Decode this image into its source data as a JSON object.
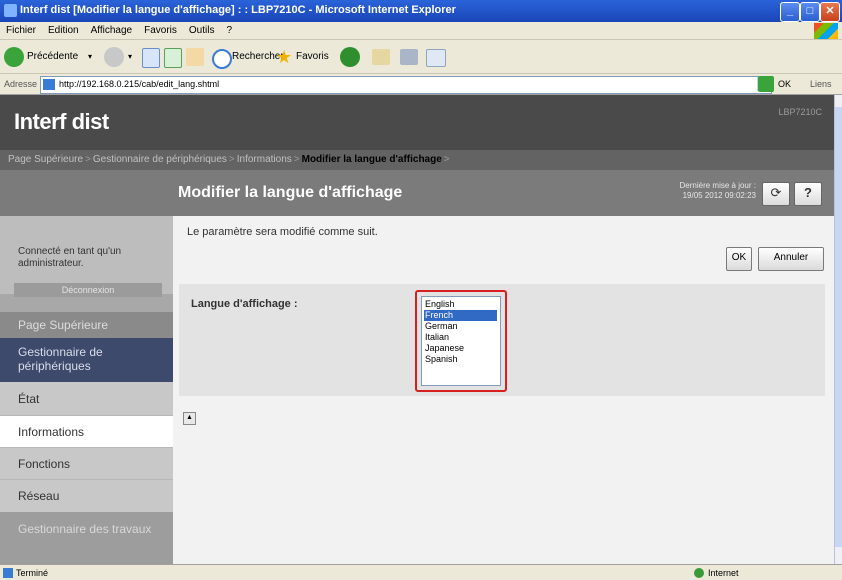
{
  "window": {
    "title": "Interf dist [Modifier la langue d'affichage] : : LBP7210C - Microsoft Internet Explorer",
    "controls": [
      "_",
      "□",
      "✕"
    ]
  },
  "menubar": [
    "Fichier",
    "Edition",
    "Affichage",
    "Favoris",
    "Outils",
    "?"
  ],
  "toolbar": {
    "back_label": "Précédente",
    "search_label": "Rechercher",
    "favorites_label": "Favoris"
  },
  "addressbar": {
    "label": "Adresse",
    "url": "http://192.168.0.215/cab/edit_lang.shtml",
    "go_label": "OK",
    "links_label": "Liens"
  },
  "header": {
    "brand": "Interf dist",
    "model": "LBP7210C"
  },
  "breadcrumb": {
    "items": [
      "Page Supérieure",
      "Gestionnaire de périphériques",
      "Informations"
    ],
    "current": "Modifier la langue d'affichage",
    "separator": ">"
  },
  "page": {
    "title": "Modifier la langue d'affichage",
    "last_update_label": "Dernière mise à jour :",
    "last_update_value": "19/05 2012 09:02:23",
    "refresh_icon": "refresh-icon",
    "help_label": "?"
  },
  "sidebar": {
    "logged_in_text": "Connecté en tant qu'un administrateur.",
    "logout_label": "Déconnexion",
    "items": [
      {
        "label": "Page Supérieure",
        "style": "dark"
      },
      {
        "label": "Gestionnaire de périphériques",
        "style": "selected"
      },
      {
        "label": "État",
        "style": "sub"
      },
      {
        "label": "Informations",
        "style": "current"
      },
      {
        "label": "Fonctions",
        "style": "sub"
      },
      {
        "label": "Réseau",
        "style": "sub"
      },
      {
        "label": "Gestionnaire des travaux",
        "style": "bottom"
      }
    ]
  },
  "main": {
    "message": "Le paramètre sera modifié comme suit.",
    "ok_label": "OK",
    "cancel_label": "Annuler",
    "setting_label": "Langue d'affichage :",
    "languages": [
      "English",
      "French",
      "German",
      "Italian",
      "Japanese",
      "Spanish"
    ],
    "selected_language": "French"
  },
  "statusbar": {
    "status": "Terminé",
    "zone": "Internet"
  },
  "colors": {
    "title_bar": "#1946b8",
    "header_bg": "#4a4a4a",
    "selected_nav": "#3e4a6c",
    "highlight_border": "#d62020",
    "selection_blue": "#316ac5"
  }
}
